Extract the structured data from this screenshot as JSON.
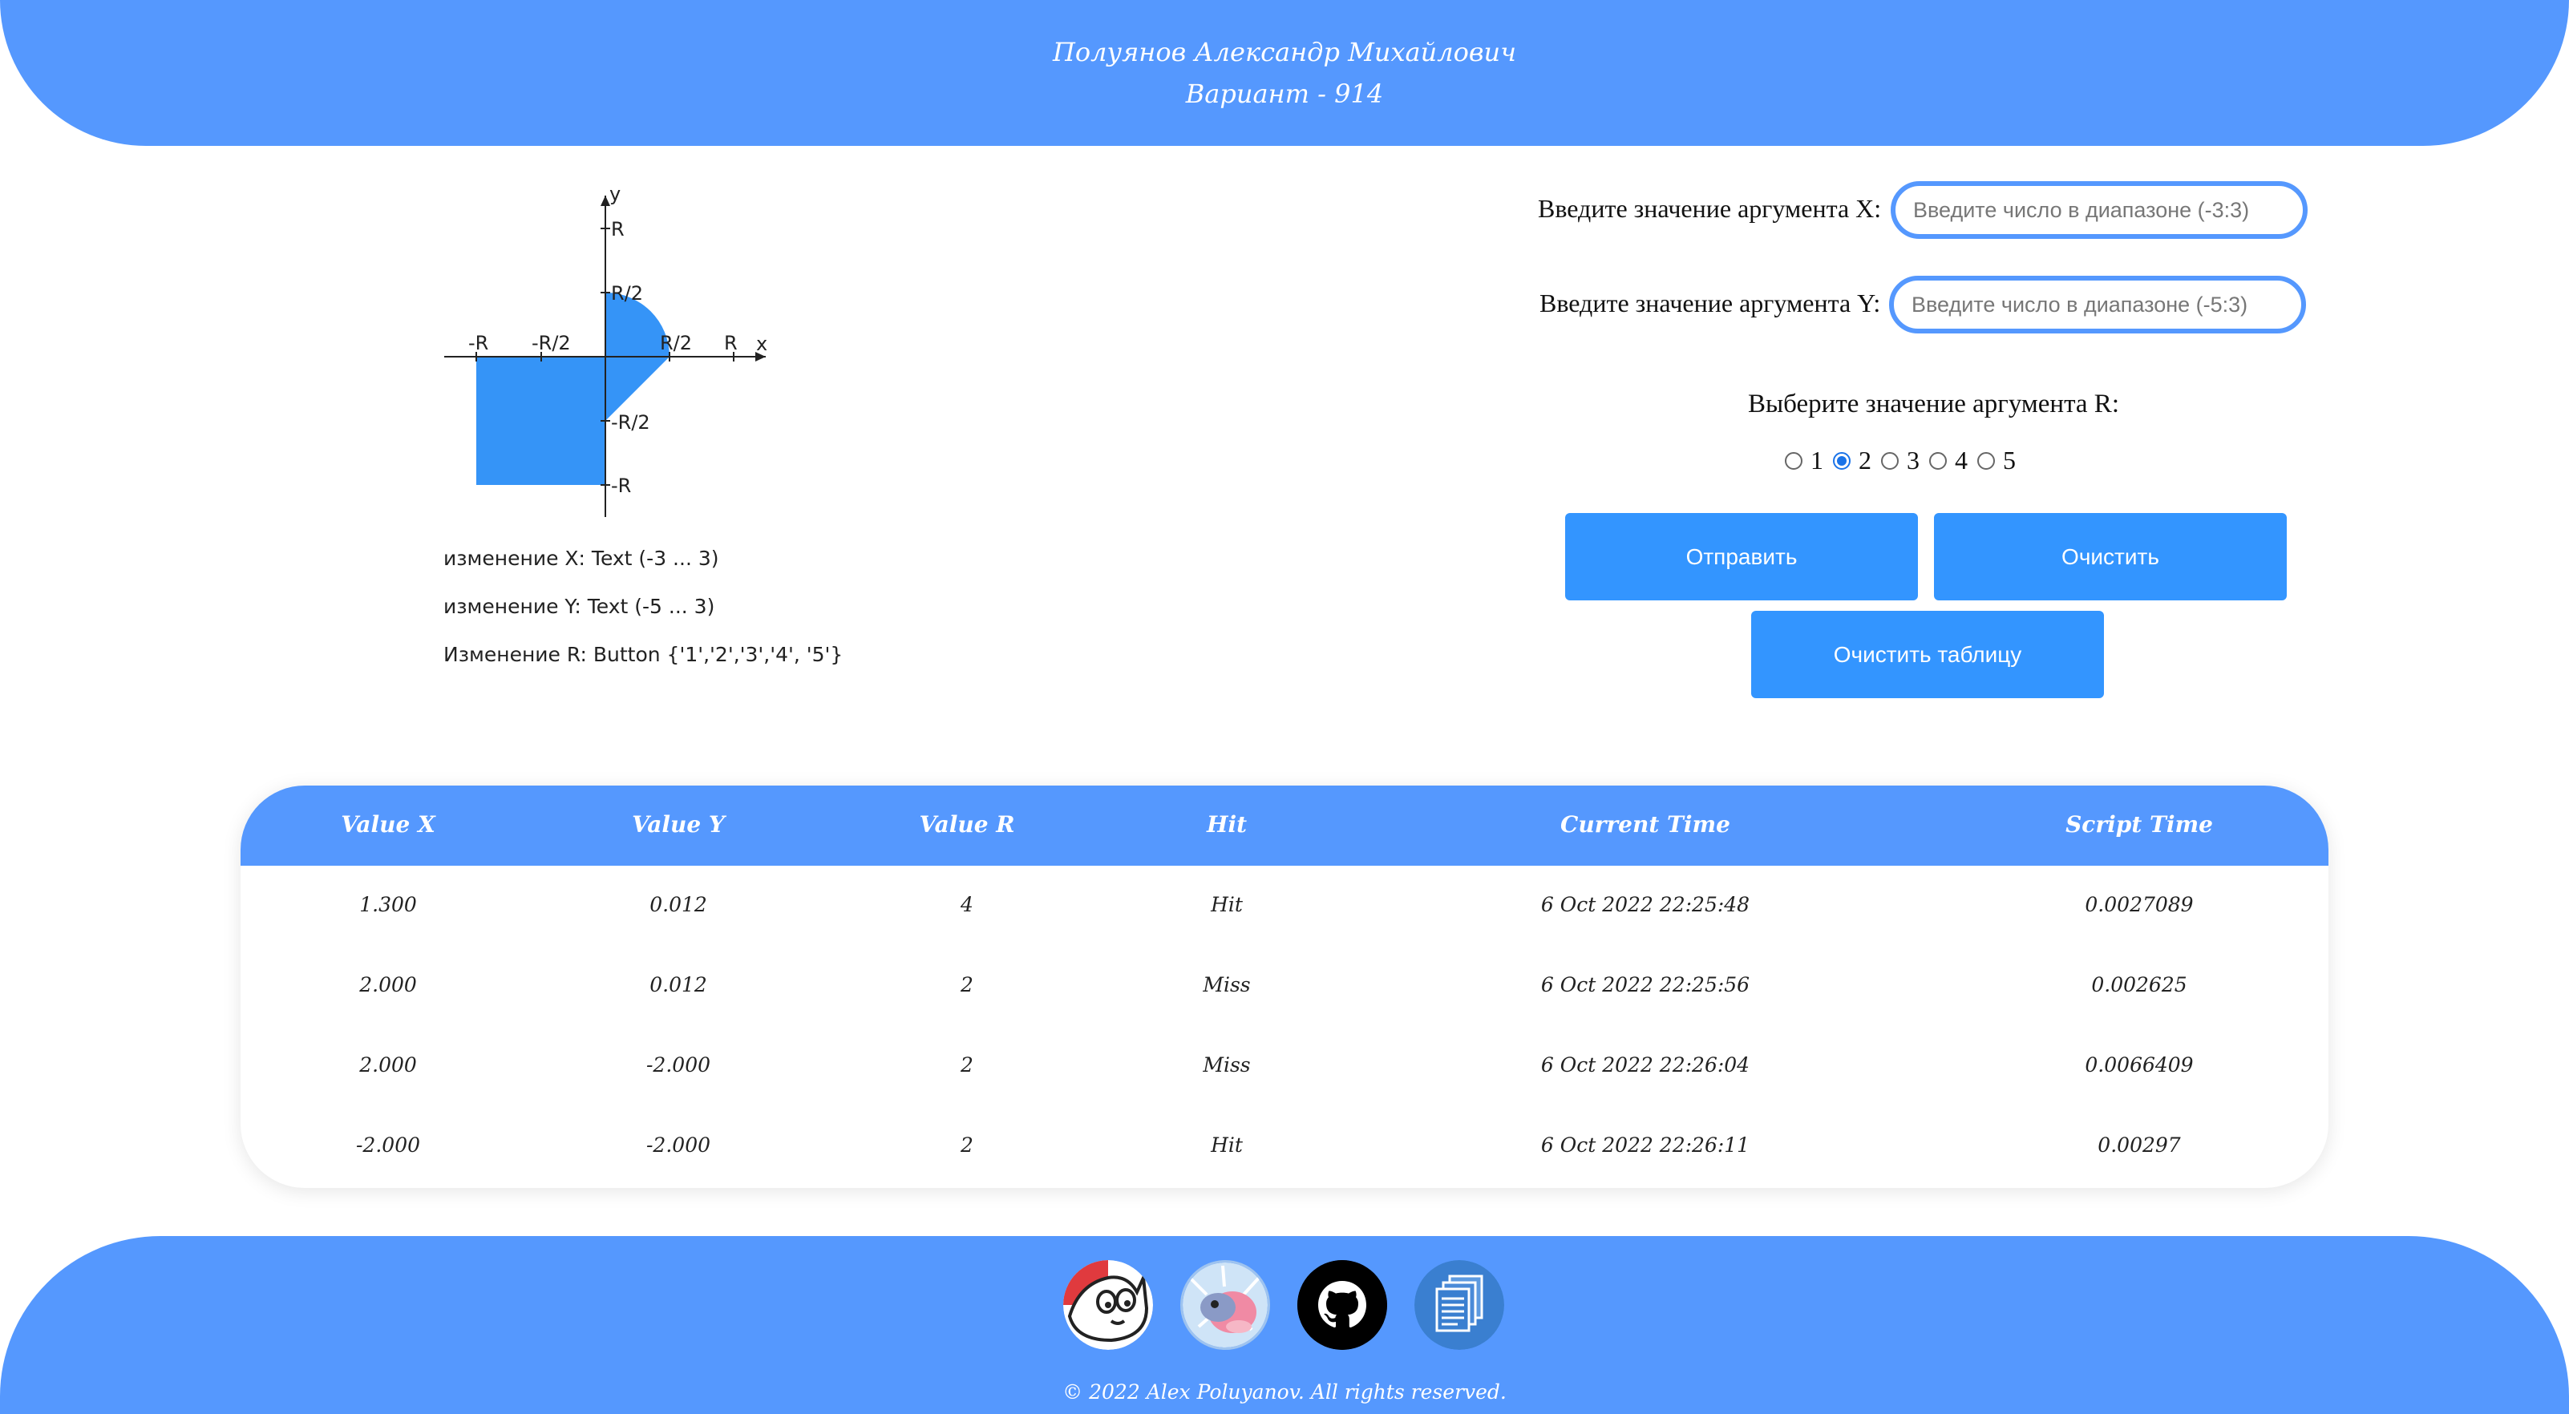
{
  "header": {
    "name": "Полуянов Александр Михайлович",
    "variant": "Вариант - 914"
  },
  "graph": {
    "axis_x": "x",
    "axis_y": "y",
    "labels": {
      "R_top": "R",
      "R2_top": "R/2",
      "neg_R_left": "-R",
      "neg_R2_left": "-R/2",
      "R2_right": "R/2",
      "R_right": "R",
      "neg_R2_bottom": "-R/2",
      "neg_R_bottom": "-R"
    },
    "area_color": "#3594f7"
  },
  "info": {
    "x_line": "изменение X: Text (-3 ... 3)",
    "y_line": "изменение Y: Text (-5 ... 3)",
    "r_line": "Изменение R: Button {'1','2','3','4', '5'}"
  },
  "form": {
    "x_label": "Введите значение аргумента X:",
    "x_placeholder": "Введите число в диапазоне (-3:3)",
    "y_label": "Введите значение аргумента Y:",
    "y_placeholder": "Введите число в диапазоне (-5:3)",
    "r_label": "Выберите значение аргумента R:",
    "r_options": [
      "1",
      "2",
      "3",
      "4",
      "5"
    ],
    "r_selected": "2",
    "submit_label": "Отправить",
    "clear_label": "Очистить",
    "clear_table_label": "Очистить таблицу"
  },
  "table": {
    "headers": [
      "Value X",
      "Value Y",
      "Value R",
      "Hit",
      "Current Time",
      "Script Time"
    ],
    "rows": [
      [
        "1.300",
        "0.012",
        "4",
        "Hit",
        "6 Oct 2022 22:25:48",
        "0.0027089"
      ],
      [
        "2.000",
        "0.012",
        "2",
        "Miss",
        "6 Oct 2022 22:25:56",
        "0.002625"
      ],
      [
        "2.000",
        "-2.000",
        "2",
        "Miss",
        "6 Oct 2022 22:26:04",
        "0.0066409"
      ],
      [
        "-2.000",
        "-2.000",
        "2",
        "Hit",
        "6 Oct 2022 22:26:11",
        "0.00297"
      ]
    ]
  },
  "footer": {
    "icons": [
      "cat-avatar-icon",
      "character-avatar-icon",
      "github-icon",
      "documents-icon"
    ],
    "copyright": "© 2022 Alex Poluyanov. All rights reserved."
  },
  "colors": {
    "brand": "#5598fe",
    "button": "#3395ff",
    "area": "#3594f7"
  }
}
